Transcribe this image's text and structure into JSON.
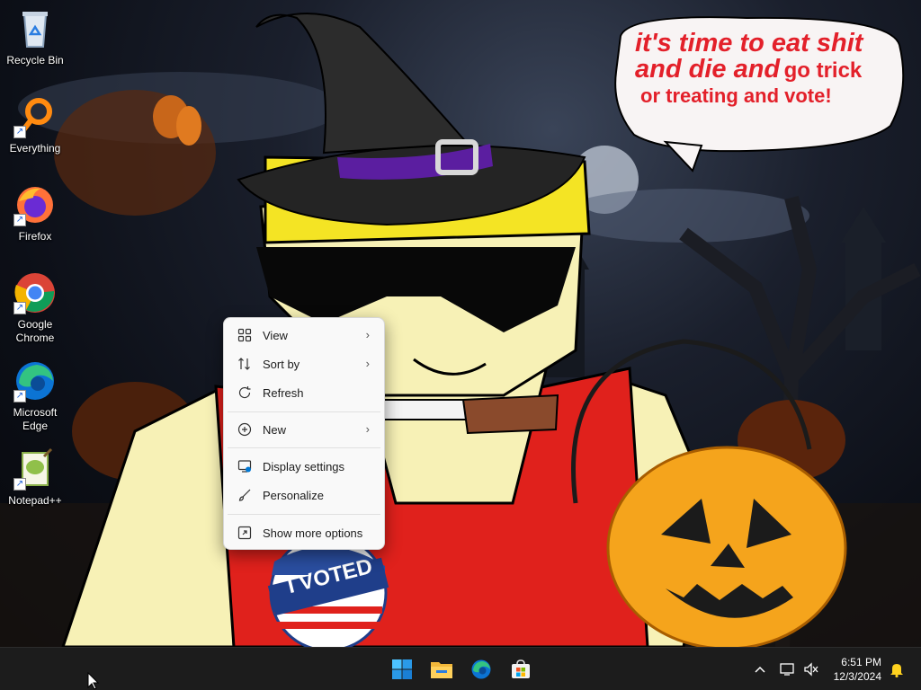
{
  "desktop": {
    "icons": [
      {
        "label": "Recycle Bin",
        "icon": "recycle-bin-icon"
      },
      {
        "label": "Everything",
        "icon": "everything-search-icon"
      },
      {
        "label": "Firefox",
        "icon": "firefox-icon"
      },
      {
        "label": "Google Chrome",
        "icon": "chrome-icon"
      },
      {
        "label": "Microsoft Edge",
        "icon": "edge-icon"
      },
      {
        "label": "Notepad++",
        "icon": "notepadpp-icon"
      }
    ]
  },
  "wallpaper": {
    "bubble": {
      "line1": "it's time to eat shit",
      "line2a": "and die and",
      "line2b": "go trick",
      "line3": "or treating and vote!"
    },
    "badge": "I VOTED",
    "colors": {
      "bubble_text": "#e3202a",
      "shirt": "#e0211c",
      "pumpkin": "#f5a41c"
    }
  },
  "context_menu": {
    "items": [
      {
        "label": "View",
        "icon": "grid-view-icon",
        "submenu": true
      },
      {
        "label": "Sort by",
        "icon": "sort-icon",
        "submenu": true
      },
      {
        "label": "Refresh",
        "icon": "refresh-icon",
        "submenu": false
      },
      {
        "label": "New",
        "icon": "plus-circle-icon",
        "submenu": true
      },
      {
        "label": "Display settings",
        "icon": "display-settings-icon",
        "submenu": false
      },
      {
        "label": "Personalize",
        "icon": "brush-icon",
        "submenu": false
      },
      {
        "label": "Show more options",
        "icon": "show-more-icon",
        "submenu": false
      }
    ]
  },
  "taskbar": {
    "apps": [
      {
        "name": "Start",
        "icon": "windows-start-icon"
      },
      {
        "name": "File Explorer",
        "icon": "file-explorer-icon"
      },
      {
        "name": "Microsoft Edge",
        "icon": "edge-icon"
      },
      {
        "name": "Microsoft Store",
        "icon": "store-icon"
      }
    ],
    "tray": {
      "time": "6:51 PM",
      "date": "12/3/2024"
    },
    "accent": "#0078d4"
  }
}
